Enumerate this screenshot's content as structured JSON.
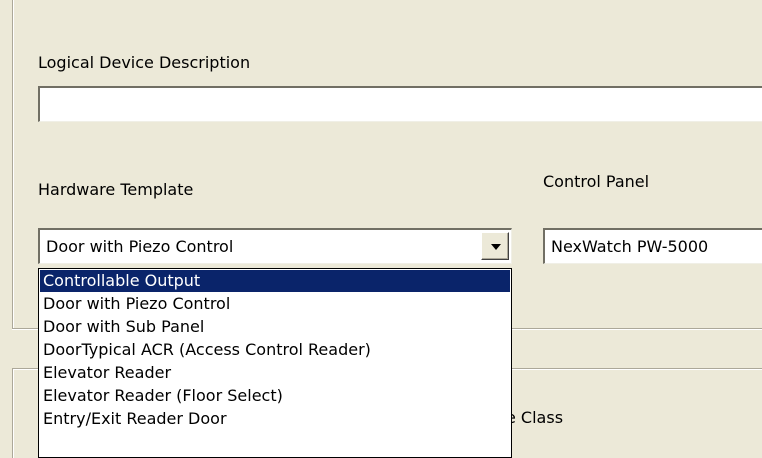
{
  "form": {
    "description_label": "Logical Device  Description",
    "description_value": "",
    "hardware_template_label": "Hardware Template",
    "hardware_template_value": "Door with Piezo Control",
    "control_panel_label": "Control Panel",
    "control_panel_value": "NexWatch PW-5000",
    "partial_label": "e Class"
  },
  "dropdown": {
    "selected_index": 0,
    "options": [
      "Controllable Output",
      "Door with Piezo Control",
      "Door with Sub Panel",
      "DoorTypical ACR (Access Control Reader)",
      "Elevator Reader",
      "Elevator Reader (Floor Select)",
      "Entry/Exit Reader Door"
    ]
  },
  "colors": {
    "window_bg": "#ece9d8",
    "selection_bg": "#0a246a",
    "selection_text": "#ffffff"
  },
  "icons": {
    "combo_button": "chevron-down-icon"
  }
}
